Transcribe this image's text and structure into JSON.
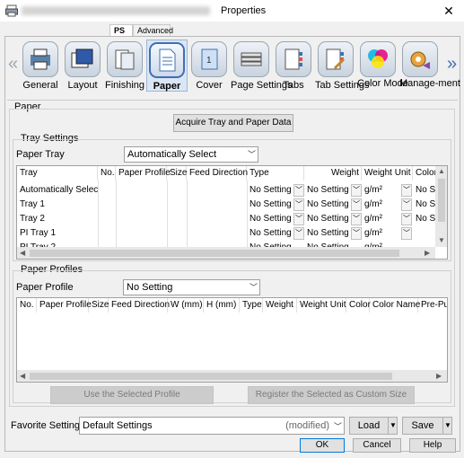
{
  "window": {
    "title": "Properties"
  },
  "tabs": [
    {
      "label": "PS",
      "active": true
    },
    {
      "label": "Advanced",
      "active": false
    }
  ],
  "nav": [
    {
      "label": "General",
      "icon": "general-icon"
    },
    {
      "label": "Layout",
      "icon": "layout-icon"
    },
    {
      "label": "Finishing",
      "icon": "finishing-icon"
    },
    {
      "label": "Paper",
      "icon": "paper-icon",
      "active": true
    },
    {
      "label": "Cover",
      "icon": "cover-icon"
    },
    {
      "label": "Page Settings",
      "icon": "page-settings-icon"
    },
    {
      "label": "Tabs",
      "icon": "tabs-icon"
    },
    {
      "label": "Tab Settings",
      "icon": "tab-settings-icon"
    },
    {
      "label": "Color Mode",
      "icon": "color-mode-icon"
    },
    {
      "label": "Manage-ment",
      "icon": "management-icon"
    }
  ],
  "paper": {
    "section_label": "Paper",
    "acquire_button": "Acquire Tray and Paper Data",
    "tray_settings": {
      "label": "Tray Settings",
      "paper_tray_label": "Paper Tray",
      "paper_tray_value": "Automatically Select",
      "columns": [
        "Tray",
        "No.",
        "Paper Profile",
        "Size",
        "Feed Direction",
        "Type",
        "Weight",
        "Weight Unit",
        "Color"
      ],
      "rows": [
        {
          "tray": "Automatically Select",
          "type": "No Setting",
          "weight": "No Setting",
          "unit": "g/m²",
          "color": "No Se"
        },
        {
          "tray": "Tray 1",
          "type": "No Setting",
          "weight": "No Setting",
          "unit": "g/m²",
          "color": "No Se"
        },
        {
          "tray": "Tray 2",
          "type": "No Setting",
          "weight": "No Setting",
          "unit": "g/m²",
          "color": "No Se"
        },
        {
          "tray": "PI Tray 1",
          "type": "No Setting",
          "weight": "No Setting",
          "unit": "g/m²",
          "color": ""
        },
        {
          "tray": "PI Tray 2",
          "type": "No Setting",
          "weight": "No Setting",
          "unit": "g/m²",
          "color": ""
        }
      ]
    },
    "paper_profiles": {
      "label": "Paper Profiles",
      "paper_profile_label": "Paper Profile",
      "paper_profile_value": "No Setting",
      "columns": [
        "No.",
        "Paper Profile",
        "Size",
        "Feed Direction",
        "W (mm)",
        "H (mm)",
        "Type",
        "Weight",
        "Weight Unit",
        "Color",
        "Color Name",
        "Pre-Pun"
      ],
      "use_button": "Use the Selected Profile",
      "register_button": "Register the Selected as Custom Size"
    }
  },
  "favorite": {
    "label": "Favorite Setting",
    "value": "Default Settings",
    "modified": "(modified)",
    "load_button": "Load",
    "save_button": "Save"
  },
  "footer": {
    "ok": "OK",
    "cancel": "Cancel",
    "help": "Help"
  },
  "colors": {
    "accent": "#3f6fb5",
    "nav_active_bg": "#dbe6f4"
  }
}
